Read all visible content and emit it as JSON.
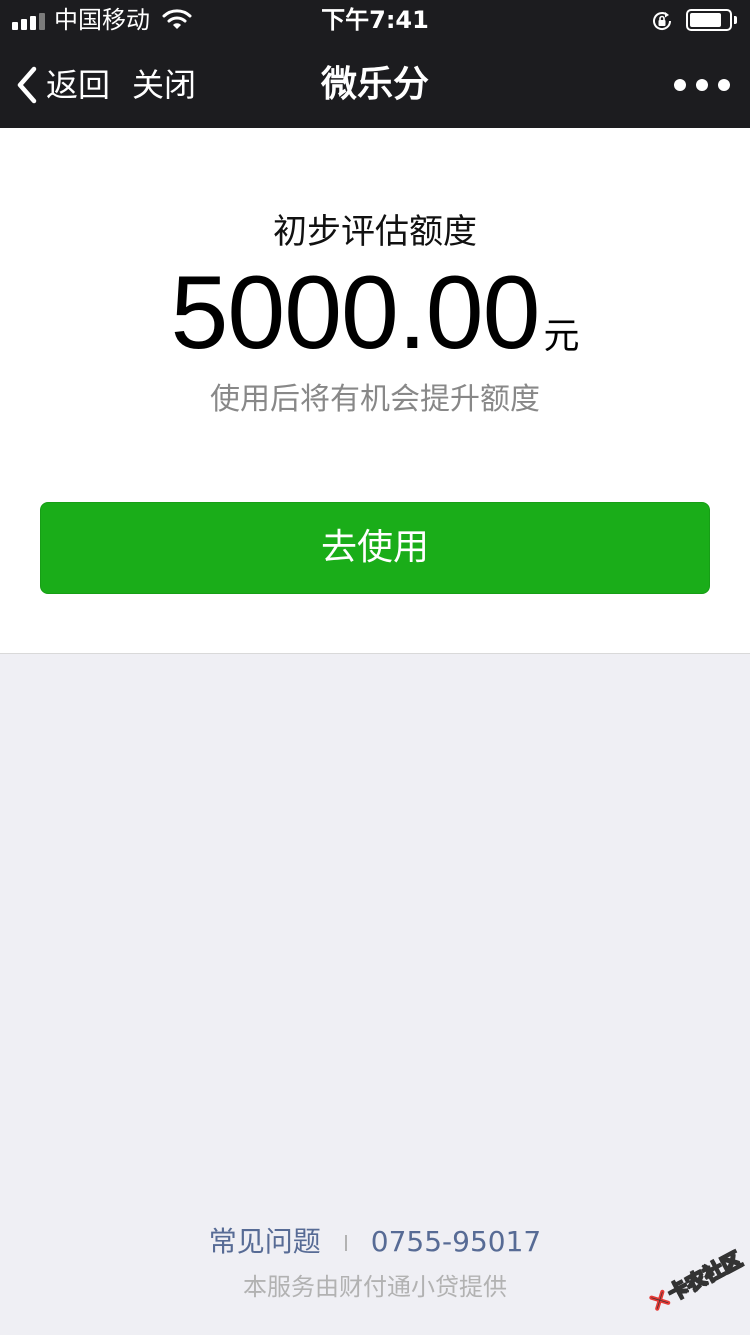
{
  "status_bar": {
    "carrier": "中国移动",
    "time": "下午7:41",
    "battery_level": 0.82,
    "icons": [
      "signal-icon",
      "wifi-icon",
      "rotation-lock-icon",
      "battery-icon"
    ]
  },
  "nav": {
    "back_label": "返回",
    "close_label": "关闭",
    "title": "微乐分",
    "icons": [
      "back-chevron-icon",
      "more-icon"
    ]
  },
  "credit": {
    "label": "初步评估额度",
    "amount": "5000.00",
    "unit": "元",
    "hint": "使用后将有机会提升额度",
    "cta_label": "去使用"
  },
  "footer": {
    "faq_label": "常见问题",
    "phone": "0755-95017",
    "provider": "本服务由财付通小贷提供"
  },
  "watermark": {
    "text": "卡农社区"
  },
  "colors": {
    "nav_background": "#1c1c1f",
    "accent_green": "#1aad19",
    "link_blue": "#576b95",
    "page_background": "#efeff4",
    "muted_text": "#888888"
  }
}
